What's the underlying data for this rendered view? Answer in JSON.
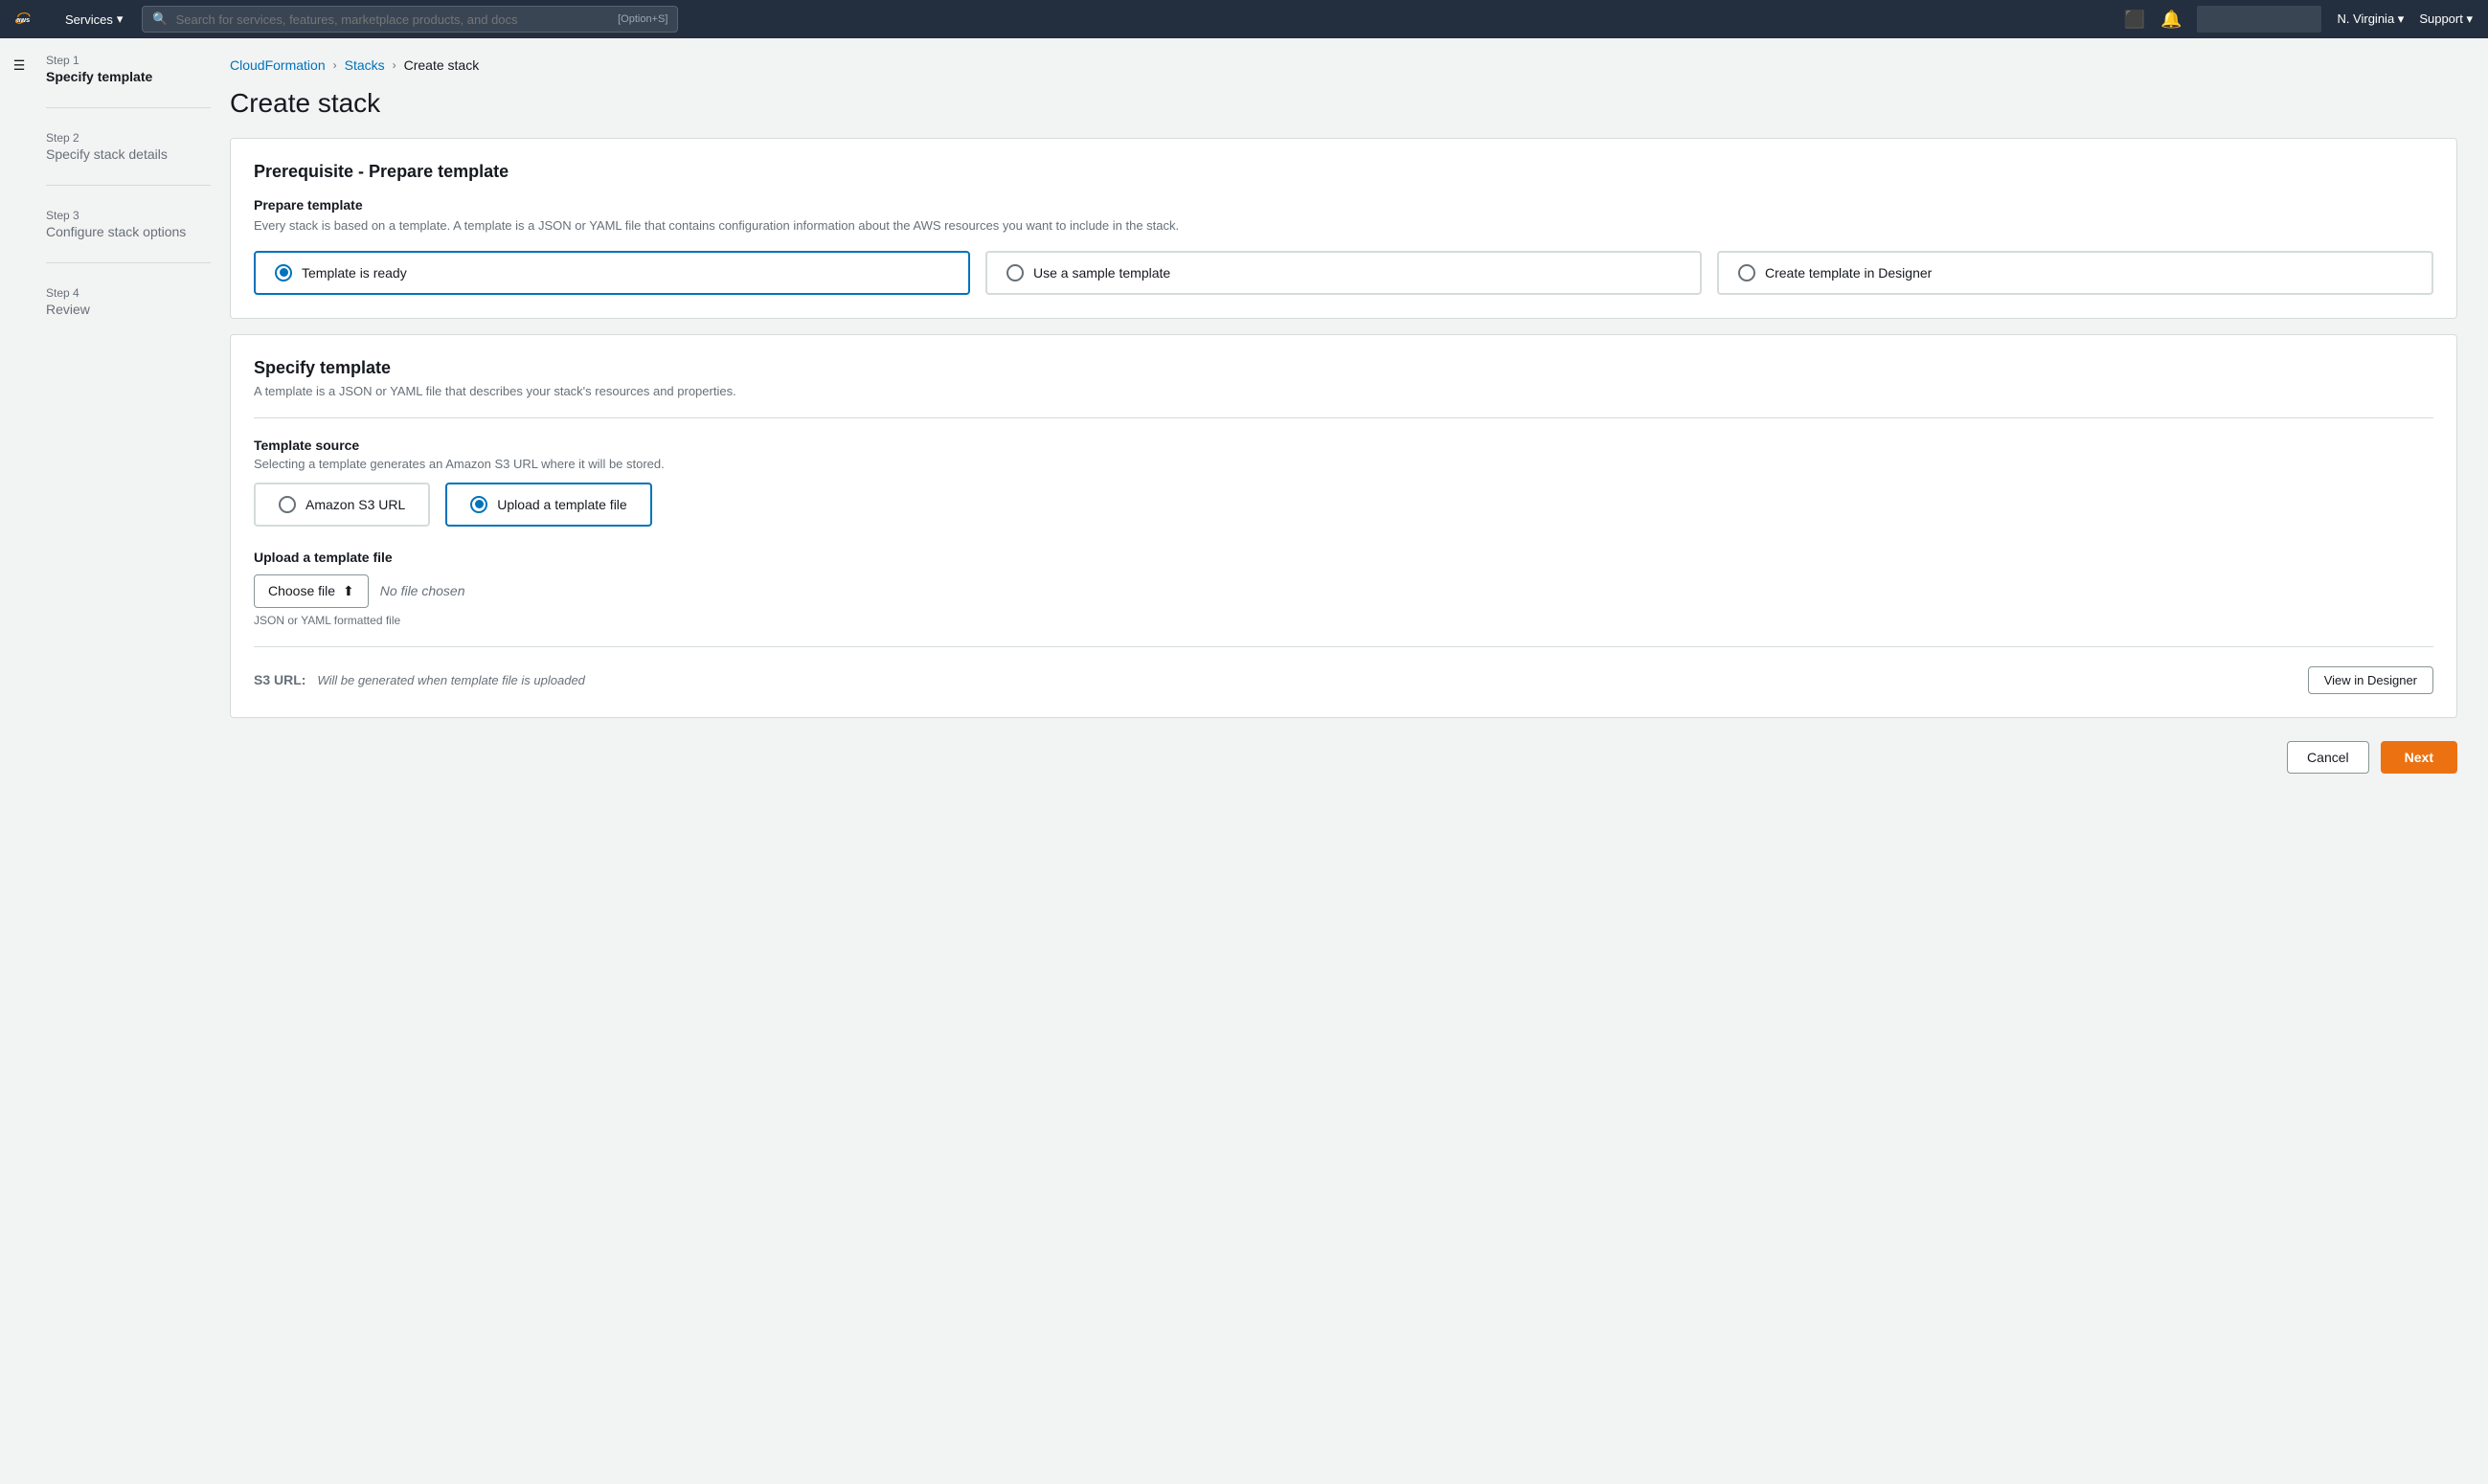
{
  "nav": {
    "services_label": "Services",
    "search_placeholder": "Search for services, features, marketplace products, and docs",
    "search_shortcut": "[Option+S]",
    "region": "N. Virginia",
    "support": "Support"
  },
  "breadcrumb": {
    "cloudformation": "CloudFormation",
    "stacks": "Stacks",
    "current": "Create stack"
  },
  "page": {
    "title": "Create stack"
  },
  "steps": [
    {
      "label": "Step 1",
      "title": "Specify template",
      "active": true
    },
    {
      "label": "Step 2",
      "title": "Specify stack details",
      "active": false
    },
    {
      "label": "Step 3",
      "title": "Configure stack options",
      "active": false
    },
    {
      "label": "Step 4",
      "title": "Review",
      "active": false
    }
  ],
  "prepare_template": {
    "card_title": "Prerequisite - Prepare template",
    "field_label": "Prepare template",
    "field_desc": "Every stack is based on a template. A template is a JSON or YAML file that contains configuration information about the AWS resources you want to include in the stack.",
    "options": [
      {
        "id": "template-ready",
        "label": "Template is ready",
        "selected": true
      },
      {
        "id": "sample-template",
        "label": "Use a sample template",
        "selected": false
      },
      {
        "id": "designer",
        "label": "Create template in Designer",
        "selected": false
      }
    ]
  },
  "specify_template": {
    "section_title": "Specify template",
    "section_desc": "A template is a JSON or YAML file that describes your stack's resources and properties.",
    "source_label": "Template source",
    "source_desc": "Selecting a template generates an Amazon S3 URL where it will be stored.",
    "sources": [
      {
        "id": "s3-url",
        "label": "Amazon S3 URL",
        "selected": false
      },
      {
        "id": "upload",
        "label": "Upload a template file",
        "selected": true
      }
    ],
    "upload_label": "Upload a template file",
    "choose_file_btn": "Choose file",
    "no_file": "No file chosen",
    "file_hint": "JSON or YAML formatted file",
    "s3_url_label": "S3 URL:",
    "s3_url_placeholder": "Will be generated when template file is uploaded",
    "view_designer_btn": "View in Designer"
  },
  "actions": {
    "cancel": "Cancel",
    "next": "Next"
  },
  "icons": {
    "upload": "⬆"
  }
}
